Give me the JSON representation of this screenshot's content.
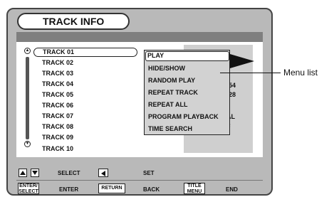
{
  "screen": {
    "title": "TRACK INFO"
  },
  "track_list": {
    "items": [
      {
        "label": "TRACK 01",
        "selected": true
      },
      {
        "label": "TRACK 02"
      },
      {
        "label": "TRACK 03"
      },
      {
        "label": "TRACK 04"
      },
      {
        "label": "TRACK 05"
      },
      {
        "label": "TRACK 06"
      },
      {
        "label": "TRACK 07"
      },
      {
        "label": "TRACK 08"
      },
      {
        "label": "TRACK 09"
      },
      {
        "label": "TRACK 10"
      }
    ]
  },
  "info_panel": {
    "time_1": "03:54",
    "time_2": "45:28",
    "fragment_1": "AL",
    "fragment_2": "F"
  },
  "menu": {
    "items": [
      {
        "label": "PLAY",
        "selected": true
      },
      {
        "label": "HIDE/SHOW"
      },
      {
        "label": "RANDOM PLAY"
      },
      {
        "label": "REPEAT TRACK"
      },
      {
        "label": "REPEAT ALL"
      },
      {
        "label": "PROGRAM PLAYBACK"
      },
      {
        "label": "TIME SEARCH"
      }
    ]
  },
  "annotation": {
    "callout": "Menu list"
  },
  "footer": {
    "select_label": "SELECT",
    "set_label": "SET",
    "enter_key": "ENTER/ SELECT",
    "enter_label": "ENTER",
    "return_key": "RETURN",
    "back_label": "BACK",
    "title_key": "TITLE MENU",
    "end_label": "END"
  },
  "icons": {
    "scroll_up": "scroll-up-icon",
    "scroll_down": "scroll-down-icon",
    "up_key": "up-arrow-icon",
    "down_key": "down-arrow-icon",
    "left_key": "left-arrow-icon"
  }
}
